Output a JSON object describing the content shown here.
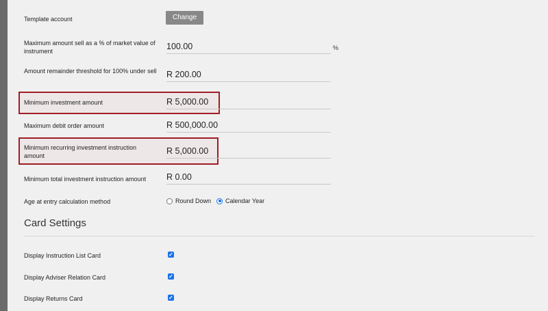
{
  "fields": [
    {
      "label": "Template account",
      "button": "Change"
    },
    {
      "label": "Maximum amount sell as a % of market value of instrument",
      "value": "100.00",
      "unit": "%"
    },
    {
      "label": "Amount remainder threshold for 100% under sell",
      "value": "R 200.00"
    },
    {
      "label": "Minimum investment amount",
      "value": "R 5,000.00"
    },
    {
      "label": "Maximum debit order amount",
      "value": "R 500,000.00"
    },
    {
      "label": "Minimum recurring investment instruction amount",
      "value": "R 5,000.00"
    },
    {
      "label": "Minimum total investment instruction amount",
      "value": "R 0.00"
    },
    {
      "label": "Age at entry calculation method",
      "options": [
        "Round Down",
        "Calendar Year"
      ],
      "selected": "Calendar Year"
    }
  ],
  "card_settings": {
    "title": "Card Settings",
    "items": [
      {
        "label": "Display Instruction List Card",
        "checked": true
      },
      {
        "label": "Display Adviser Relation Card",
        "checked": true
      },
      {
        "label": "Display Returns Card",
        "checked": true
      }
    ]
  },
  "colors": {
    "highlight": "#a01c24",
    "accent": "#1a73e8",
    "button": "#888888"
  }
}
